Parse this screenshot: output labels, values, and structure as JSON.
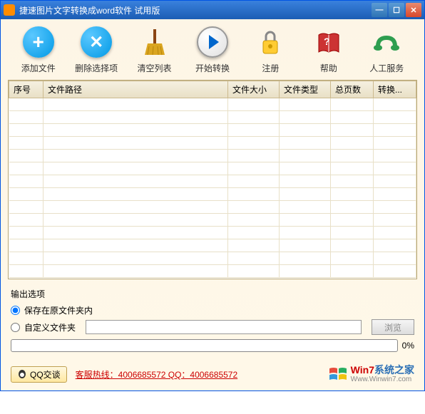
{
  "window": {
    "title": "捷速图片文字转换成word软件  试用版"
  },
  "toolbar": {
    "add": "添加文件",
    "delete": "删除选择项",
    "clear": "清空列表",
    "start": "开始转换",
    "register": "注册",
    "help": "帮助",
    "service": "人工服务"
  },
  "columns": {
    "index": "序号",
    "path": "文件路径",
    "size": "文件大小",
    "type": "文件类型",
    "pages": "总页数",
    "convert": "转换..."
  },
  "options": {
    "title": "输出选项",
    "radio_original": "保存在原文件夹内",
    "radio_custom": "自定义文件夹",
    "browse": "浏览",
    "progress_pct": "0%"
  },
  "footer": {
    "qq": "QQ交谈",
    "hotline": "客服热线：4006685572 QQ：4006685572",
    "wm_brand_a": "Win7",
    "wm_brand_b": "系统之家",
    "wm_url": "Www.Winwin7.com"
  }
}
